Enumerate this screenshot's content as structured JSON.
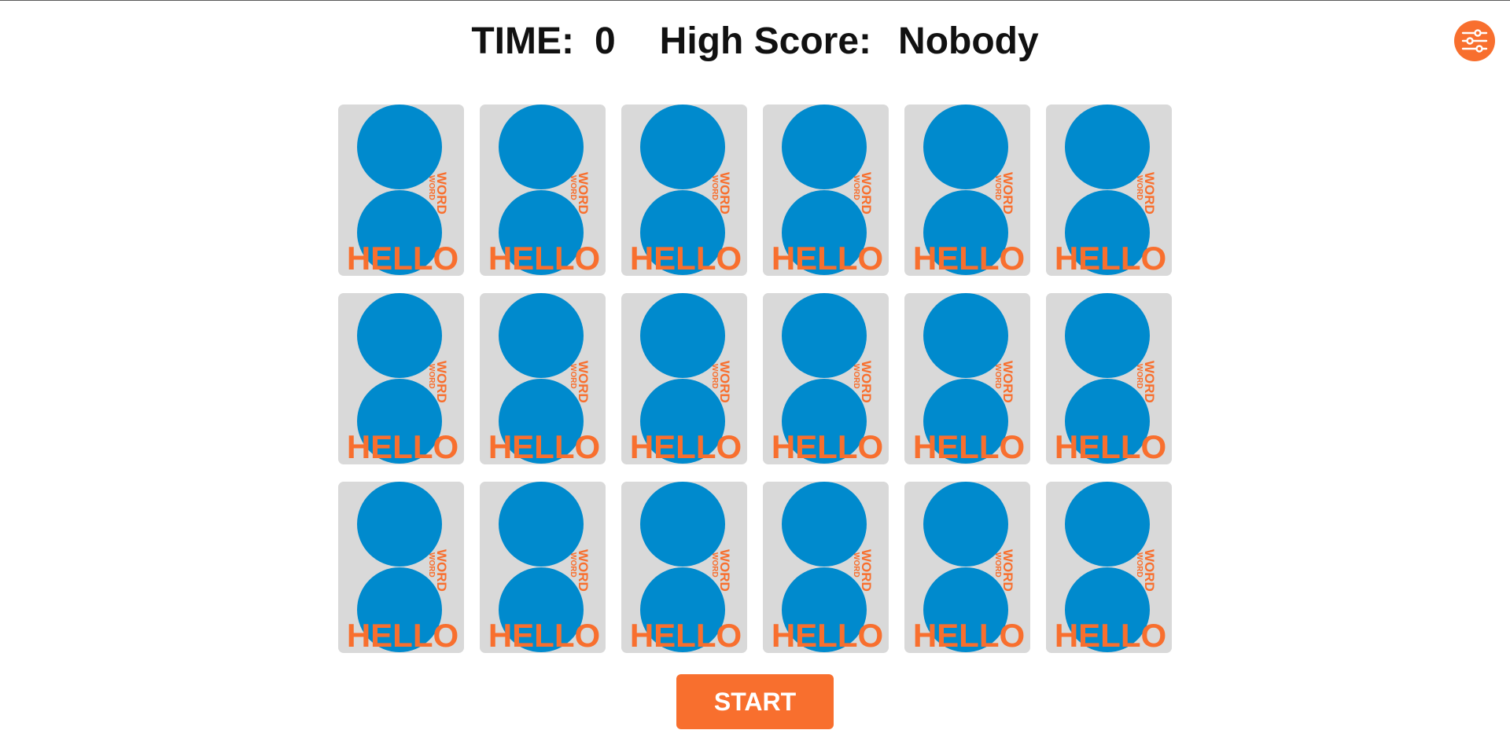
{
  "header": {
    "time_label": "TIME:",
    "time_value": "0",
    "high_score_label": "High Score:",
    "high_score_value": "Nobody"
  },
  "settings": {
    "icon": "sliders-icon"
  },
  "card_back": {
    "word_main": "HELLO",
    "word_side": "WORD",
    "word_side_small": "WORD"
  },
  "cards_count": 18,
  "start_button": {
    "label": "START"
  },
  "colors": {
    "accent": "#f86f2e",
    "circle": "#008acd",
    "card_bg": "#d9d9d9",
    "text": "#111111"
  }
}
